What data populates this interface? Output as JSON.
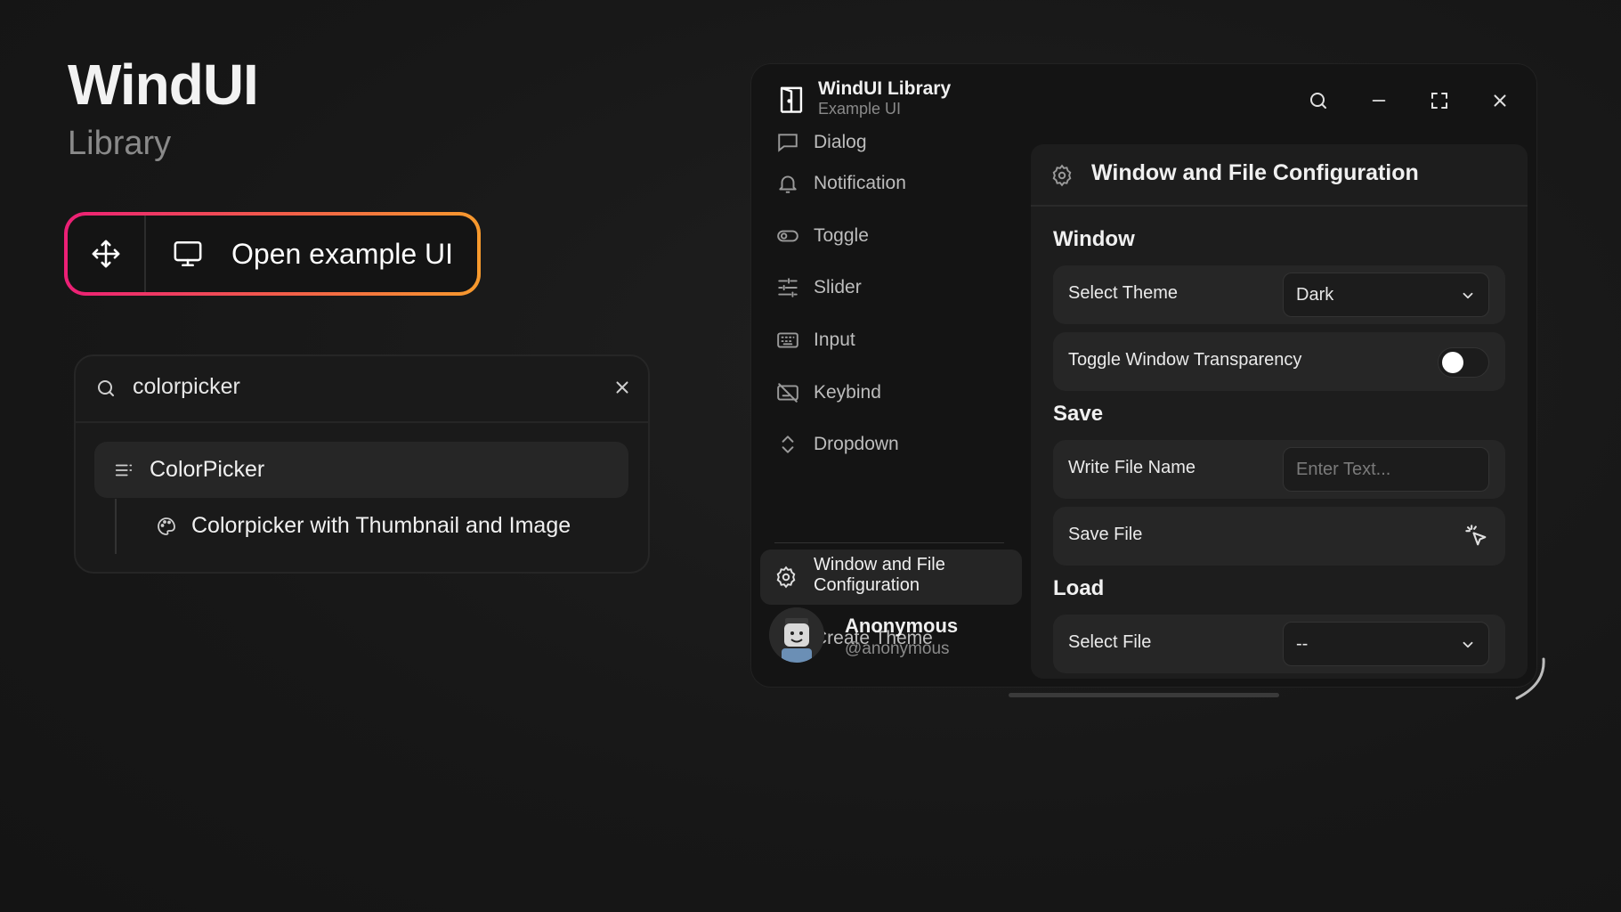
{
  "hero": {
    "title": "WindUI",
    "subtitle": "Library"
  },
  "open_button": {
    "label": "Open example UI"
  },
  "search": {
    "value": "colorpicker",
    "results": [
      {
        "label": "ColorPicker",
        "icon": "list-icon"
      },
      {
        "label": "Colorpicker with Thumbnail and Image",
        "icon": "palette-icon"
      }
    ]
  },
  "window": {
    "title": "WindUI Library",
    "subtitle": "Example UI"
  },
  "sidebar": {
    "items": [
      {
        "label": "Dialog",
        "icon": "message-icon"
      },
      {
        "label": "Notification",
        "icon": "bell-icon"
      },
      {
        "label": "Toggle",
        "icon": "toggle-icon"
      },
      {
        "label": "Slider",
        "icon": "sliders-icon"
      },
      {
        "label": "Input",
        "icon": "keyboard-icon"
      },
      {
        "label": "Keybind",
        "icon": "keybind-icon"
      },
      {
        "label": "Dropdown",
        "icon": "chevrons-icon"
      },
      {
        "label": "Window and File Configuration",
        "icon": "gear-icon",
        "active": true
      },
      {
        "label": "Create Theme",
        "icon": "palette-icon"
      }
    ],
    "user": {
      "name": "Anonymous",
      "handle": "@anonymous"
    }
  },
  "content": {
    "title": "Window and File Configuration",
    "sections": {
      "window": "Window",
      "save": "Save",
      "load": "Load"
    },
    "select_theme": {
      "label": "Select Theme",
      "value": "Dark"
    },
    "transparency": {
      "label": "Toggle Window Transparency",
      "enabled": false
    },
    "file_name": {
      "label": "Write File Name",
      "placeholder": "Enter Text..."
    },
    "save_file": {
      "label": "Save File"
    },
    "select_file": {
      "label": "Select File",
      "value": "--"
    }
  },
  "colors": {
    "accent_start": "#ec1f76",
    "accent_end": "#f79a2d",
    "background": "#171717"
  }
}
